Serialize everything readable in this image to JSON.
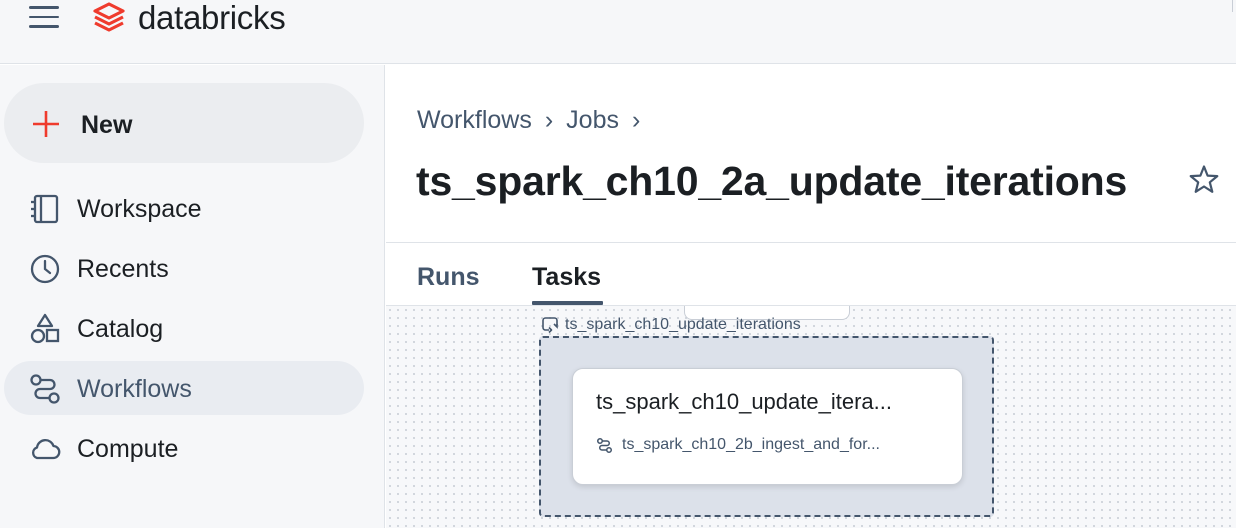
{
  "app": {
    "brand": "databricks",
    "colors": {
      "brand_red": "#ef3b2d",
      "nav_slate": "#44566c",
      "text_dark": "#1b1f23",
      "sidebar_bg": "#f6f7f9"
    }
  },
  "topbar": {
    "menu_icon": "hamburger-menu-icon",
    "logo_icon": "databricks-logo-icon"
  },
  "sidebar": {
    "new_button": {
      "label": "New",
      "icon": "plus-icon"
    },
    "items": [
      {
        "label": "Workspace",
        "icon": "workspace-icon",
        "active": false
      },
      {
        "label": "Recents",
        "icon": "clock-icon",
        "active": false
      },
      {
        "label": "Catalog",
        "icon": "catalog-icon",
        "active": false
      },
      {
        "label": "Workflows",
        "icon": "workflows-icon",
        "active": true
      },
      {
        "label": "Compute",
        "icon": "cloud-icon",
        "active": false
      }
    ]
  },
  "main": {
    "breadcrumb": [
      "Workflows",
      "Jobs"
    ],
    "breadcrumb_separator": "›",
    "title": "ts_spark_ch10_2a_update_iterations",
    "favorite_icon": "star-icon",
    "tabs": [
      {
        "label": "Runs",
        "active": false
      },
      {
        "label": "Tasks",
        "active": true
      }
    ],
    "dag": {
      "loop_task_label": "ts_spark_ch10_update_iterations",
      "loop_icon": "for-each-loop-icon",
      "nested_task": {
        "title": "ts_spark_ch10_update_itera...",
        "job_ref": "ts_spark_ch10_2b_ingest_and_for...",
        "job_icon": "workflow-job-icon"
      }
    }
  }
}
